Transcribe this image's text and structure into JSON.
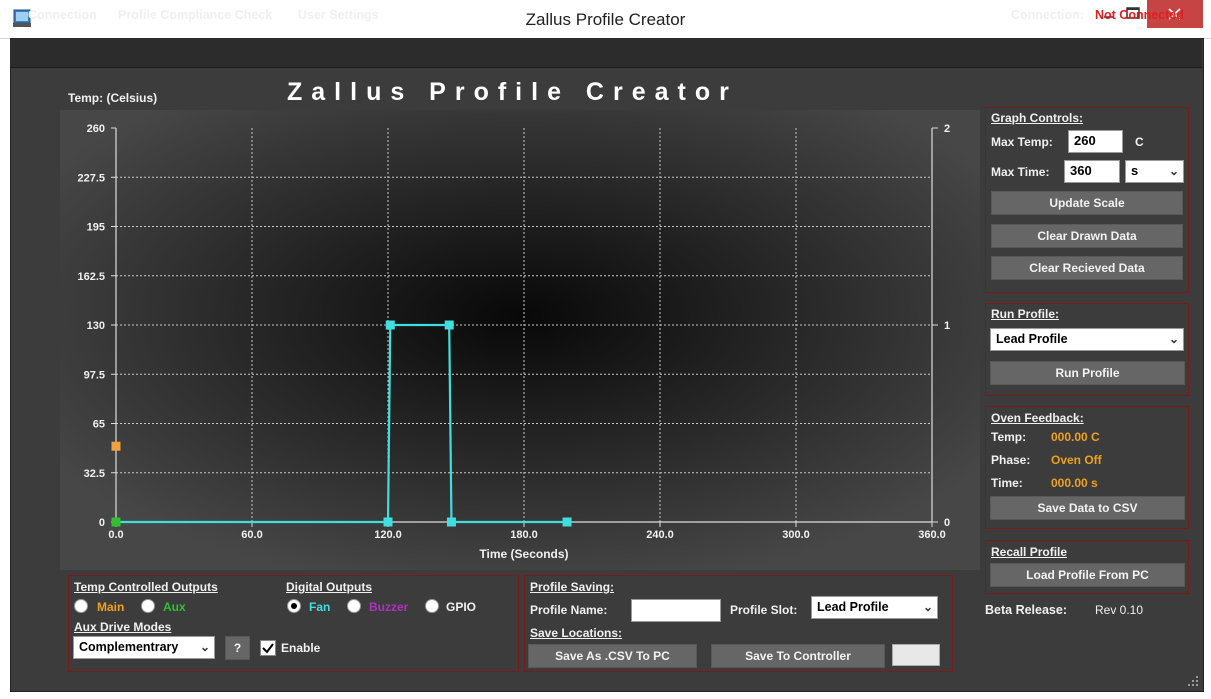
{
  "window": {
    "title": "Zallus Profile Creator"
  },
  "menu": {
    "items": [
      "Connection",
      "Profile Compliance Check",
      "User Settings"
    ],
    "connection_label": "Connection:",
    "connection_status": "Not Connected"
  },
  "header": {
    "title": "Zallus Profile Creator",
    "y_axis_label": "Temp: (Celsius)"
  },
  "chart_data": {
    "type": "line",
    "ylabel": "Temp: (Celsius)",
    "xlabel": "Time (Seconds)",
    "xlim": [
      0,
      360
    ],
    "ylim": [
      0,
      260
    ],
    "y2lim": [
      0,
      2
    ],
    "x_ticks": [
      "0.0",
      "60.0",
      "120.0",
      "180.0",
      "240.0",
      "300.0",
      "360.0"
    ],
    "y_ticks": [
      "0",
      "32.5",
      "65",
      "97.5",
      "130",
      "162.5",
      "195",
      "227.5",
      "260"
    ],
    "y2_ticks": [
      "0",
      "1",
      "2"
    ],
    "grid": true,
    "series": [
      {
        "color": "#40dede",
        "axis": "right",
        "points": [
          [
            0,
            0
          ],
          [
            120,
            0
          ],
          [
            121,
            1
          ],
          [
            147,
            1
          ],
          [
            148,
            0
          ],
          [
            199,
            0
          ]
        ]
      },
      {
        "color": "#30c030",
        "axis": "left",
        "points": [
          [
            0,
            0
          ]
        ]
      },
      {
        "color": "#f0a040",
        "axis": "left",
        "points": [
          [
            0,
            50
          ]
        ]
      }
    ]
  },
  "graph_controls": {
    "title": "Graph Controls:",
    "max_temp_label": "Max Temp:",
    "max_temp_value": "260",
    "max_temp_unit": "C",
    "max_time_label": "Max Time:",
    "max_time_value": "360",
    "max_time_unit": "s",
    "update_scale": "Update Scale",
    "clear_drawn": "Clear Drawn Data",
    "clear_received": "Clear Recieved Data"
  },
  "run_profile": {
    "title": "Run Profile:",
    "selected": "Lead Profile",
    "button": "Run Profile"
  },
  "oven_feedback": {
    "title": "Oven Feedback:",
    "temp_label": "Temp:",
    "temp_value": "000.00 C",
    "phase_label": "Phase:",
    "phase_value": "Oven Off",
    "time_label": "Time:",
    "time_value": "000.00 s",
    "save_button": "Save Data to CSV"
  },
  "recall_profile": {
    "title": "Recall Profile",
    "button": "Load Profile From PC"
  },
  "release": {
    "label": "Beta Release:",
    "version": "Rev 0.10"
  },
  "temp_outputs": {
    "title": "Temp Controlled Outputs",
    "main": "Main",
    "aux": "Aux",
    "main_color": "#f0a020",
    "aux_color": "#30c030",
    "drive_modes_title": "Aux Drive Modes",
    "drive_mode_selected": "Complementrary",
    "help_button": "?",
    "enable_label": "Enable"
  },
  "digital_outputs": {
    "title": "Digital Outputs",
    "fan": "Fan",
    "buzzer": "Buzzer",
    "gpio": "GPIO",
    "fan_color": "#40dede",
    "buzzer_color": "#b030c0"
  },
  "profile_saving": {
    "title": "Profile Saving:",
    "name_label": "Profile Name:",
    "name_value": "",
    "slot_label": "Profile Slot:",
    "slot_value": "Lead Profile",
    "locations_title": "Save Locations:",
    "save_csv": "Save As .CSV To PC",
    "save_controller": "Save To Controller"
  }
}
